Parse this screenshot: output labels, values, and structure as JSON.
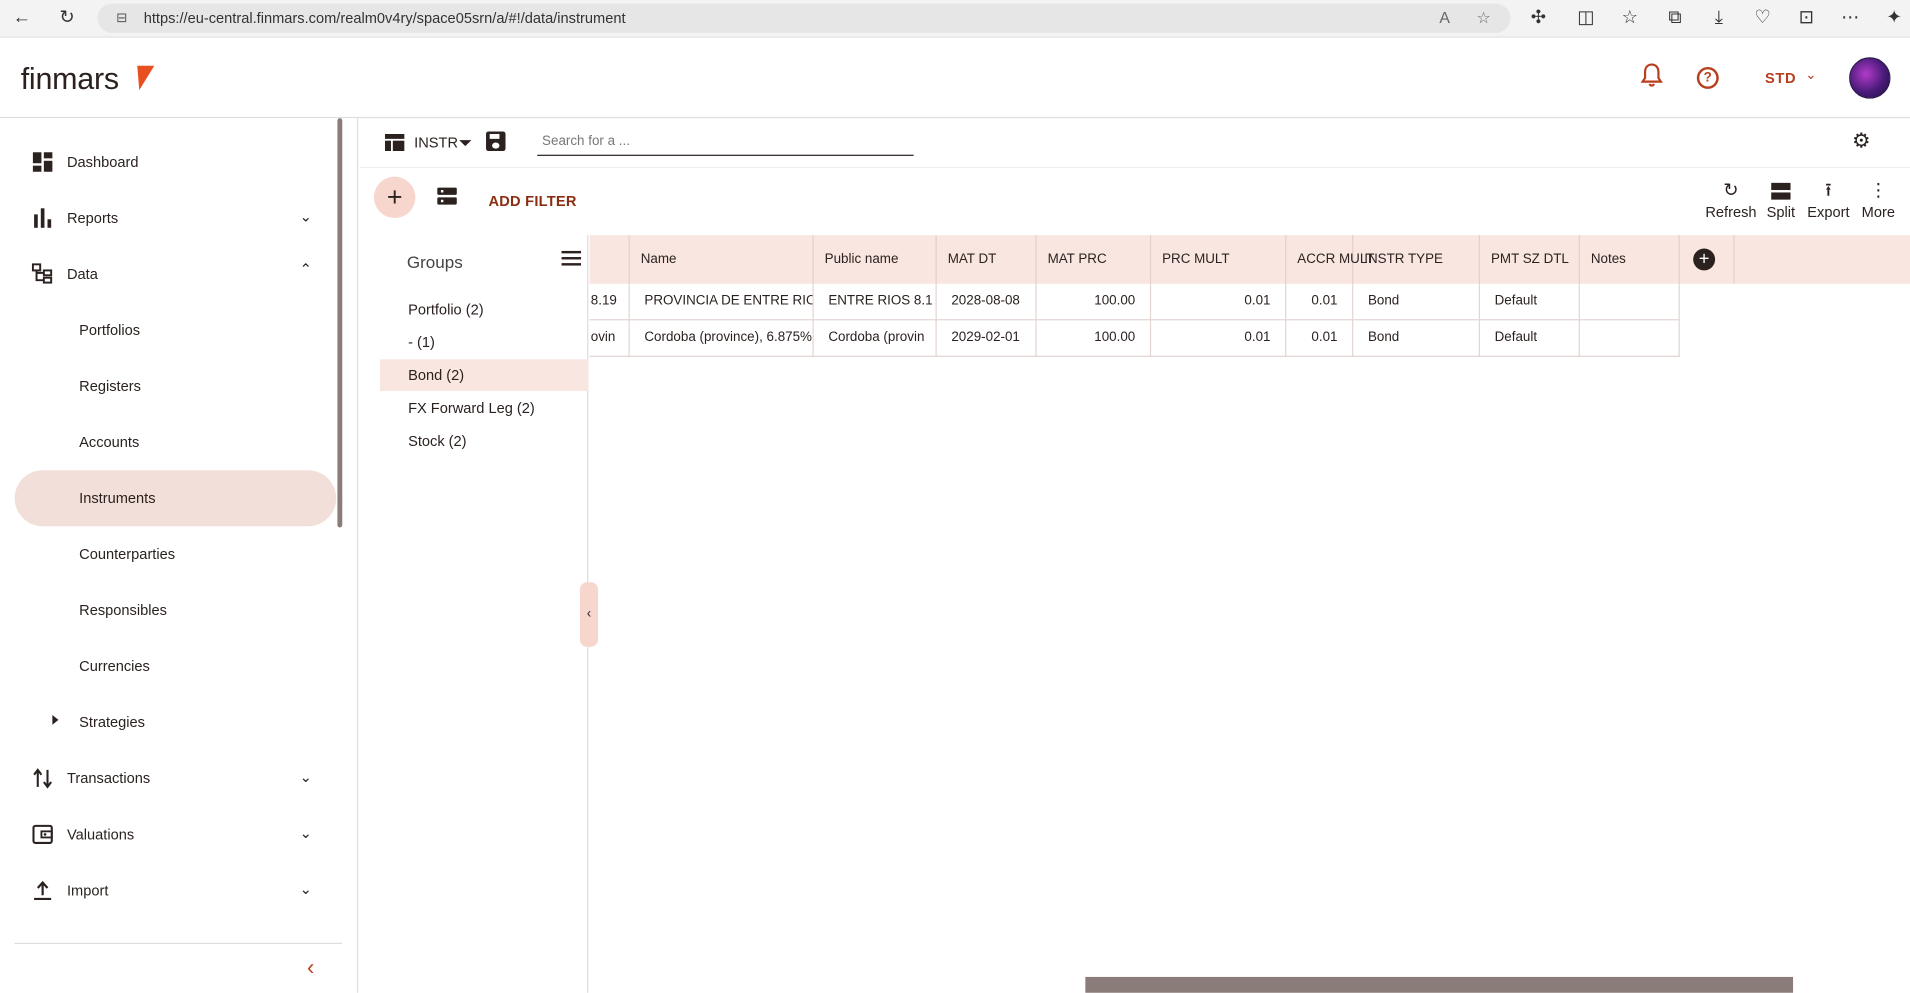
{
  "browser": {
    "url": "https://eu-central.finmars.com/realm0v4ry/space05srn/a/#!/data/instrument"
  },
  "header": {
    "logo": "finmars",
    "mode_label": "STD"
  },
  "sidebar": {
    "items": [
      {
        "label": "Dashboard"
      },
      {
        "label": "Reports"
      },
      {
        "label": "Data"
      },
      {
        "label": "Transactions"
      },
      {
        "label": "Valuations"
      },
      {
        "label": "Import"
      }
    ],
    "data_children": [
      {
        "label": "Portfolios"
      },
      {
        "label": "Registers"
      },
      {
        "label": "Accounts"
      },
      {
        "label": "Instruments"
      },
      {
        "label": "Counterparties"
      },
      {
        "label": "Responsibles"
      },
      {
        "label": "Currencies"
      },
      {
        "label": "Strategies"
      }
    ]
  },
  "toolbar": {
    "layout_label": "INSTR",
    "search_placeholder": "Search for a ...",
    "add_filter": "ADD FILTER",
    "actions": [
      {
        "label": "Refresh"
      },
      {
        "label": "Split"
      },
      {
        "label": "Export"
      },
      {
        "label": "More"
      }
    ]
  },
  "groups": {
    "title": "Groups",
    "items": [
      {
        "label": "Portfolio (2)"
      },
      {
        "label": "- (1)"
      },
      {
        "label": "Bond (2)"
      },
      {
        "label": "FX Forward Leg (2)"
      },
      {
        "label": "Stock (2)"
      }
    ]
  },
  "table": {
    "columns": [
      "Name",
      "Public name",
      "MAT DT",
      "MAT PRC",
      "PRC MULT",
      "ACCR MULT",
      "INSTR TYPE",
      "PMT SZ DTL",
      "Notes"
    ],
    "rows": [
      {
        "c0": "8.19",
        "name": "PROVINCIA DE ENTRE RIOS",
        "public_name": "ENTRE RIOS  8.1",
        "mat_dt": "2028-08-08",
        "mat_prc": "100.00",
        "prc_mult": "0.01",
        "accr_mult": "0.01",
        "instr_type": "Bond",
        "pmt_sz_dtl": "Default",
        "notes": ""
      },
      {
        "c0": "ovin",
        "name": "Cordoba (province), 6.875%",
        "public_name": "Cordoba (provin",
        "mat_dt": "2029-02-01",
        "mat_prc": "100.00",
        "prc_mult": "0.01",
        "accr_mult": "0.01",
        "instr_type": "Bond",
        "pmt_sz_dtl": "Default",
        "notes": ""
      }
    ]
  },
  "colors": {
    "accent": "#b83f1e",
    "active_bg": "#f3dfd9",
    "header_bg": "#f9e6e0"
  }
}
